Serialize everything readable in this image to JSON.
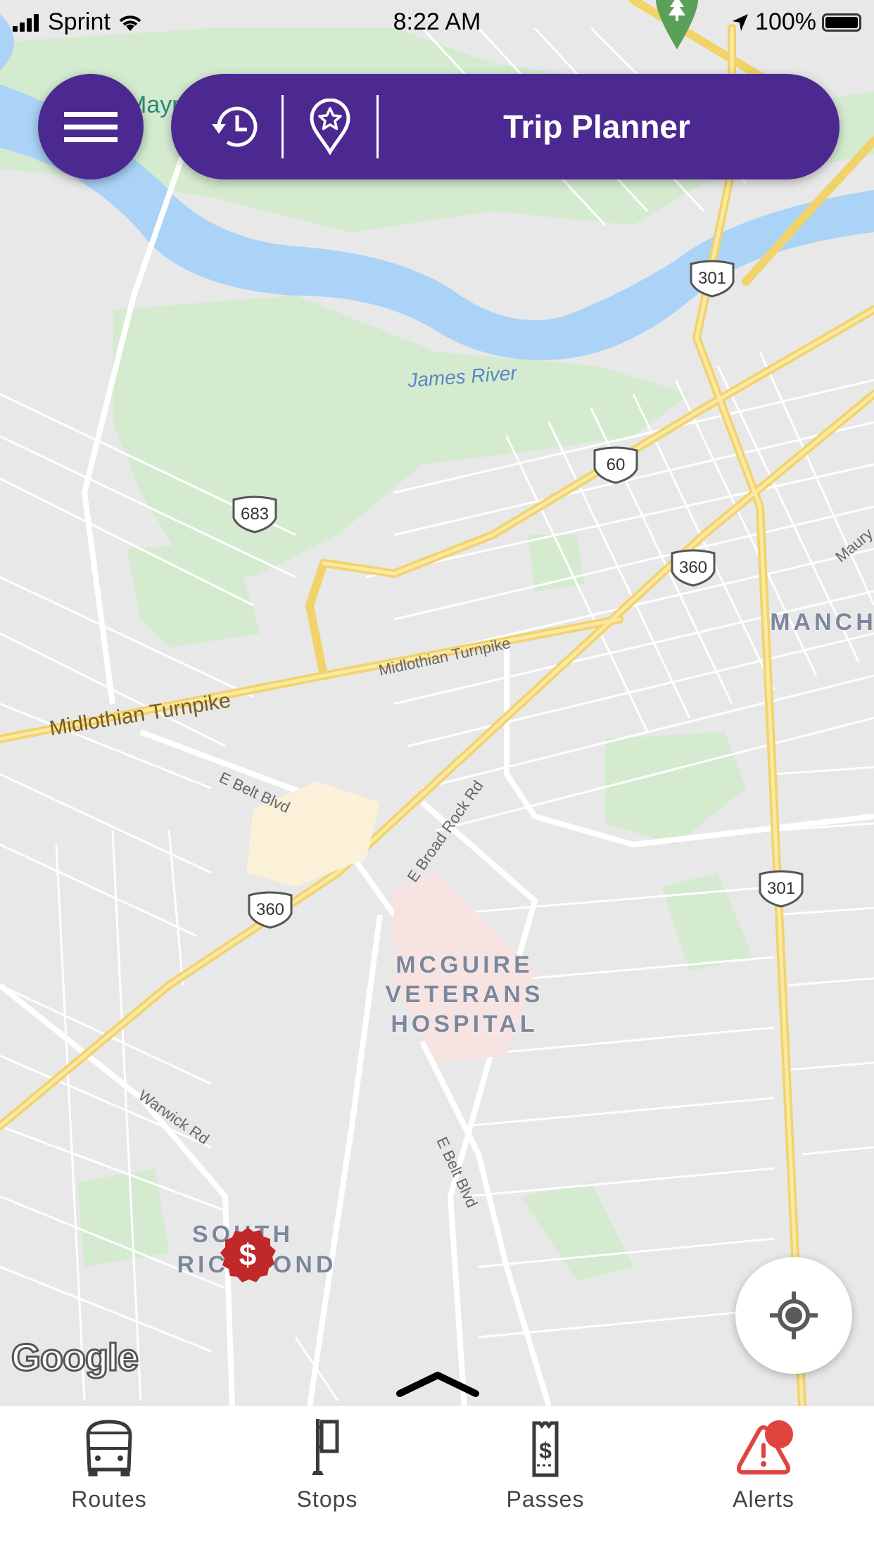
{
  "status_bar": {
    "carrier": "Sprint",
    "time": "8:22 AM",
    "battery_percent": "100%",
    "signal_bars": 4
  },
  "header": {
    "menu_icon": "hamburger-icon",
    "history_icon": "history-clock-icon",
    "favorites_icon": "favorite-location-star-icon",
    "title": "Trip Planner"
  },
  "colors": {
    "brand": "#4b2991",
    "alert": "#e0443e",
    "fare_marker": "#c0282a",
    "tab_icon": "#3a3a3a"
  },
  "map": {
    "labels": {
      "river": "James River",
      "midlothian_major": "Midlothian Turnpike",
      "midlothian_minor": "Midlothian Turnpike",
      "e_belt_blvd_1": "E Belt Blvd",
      "e_belt_blvd_2": "E Belt Blvd",
      "e_broad_rock": "E Broad Rock Rd",
      "warwick": "Warwick Rd",
      "hospital": [
        "MCGUIRE",
        "VETERANS",
        "HOSPITAL"
      ],
      "south_richmond": [
        "SOUTH",
        "RICHMOND"
      ],
      "manchester": "MANCH",
      "maury": "Maury",
      "maymont": "Maym"
    },
    "shields": [
      "301",
      "60",
      "683",
      "360",
      "360",
      "301"
    ],
    "attribution": "Google",
    "fare_marker_symbol": "$"
  },
  "locate_button": {
    "icon": "my-location-icon"
  },
  "tabs": [
    {
      "label": "Routes",
      "icon": "bus-icon"
    },
    {
      "label": "Stops",
      "icon": "bus-stop-sign-icon"
    },
    {
      "label": "Passes",
      "icon": "ticket-pass-icon"
    },
    {
      "label": "Alerts",
      "icon": "alert-triangle-icon",
      "has_badge": true
    }
  ]
}
